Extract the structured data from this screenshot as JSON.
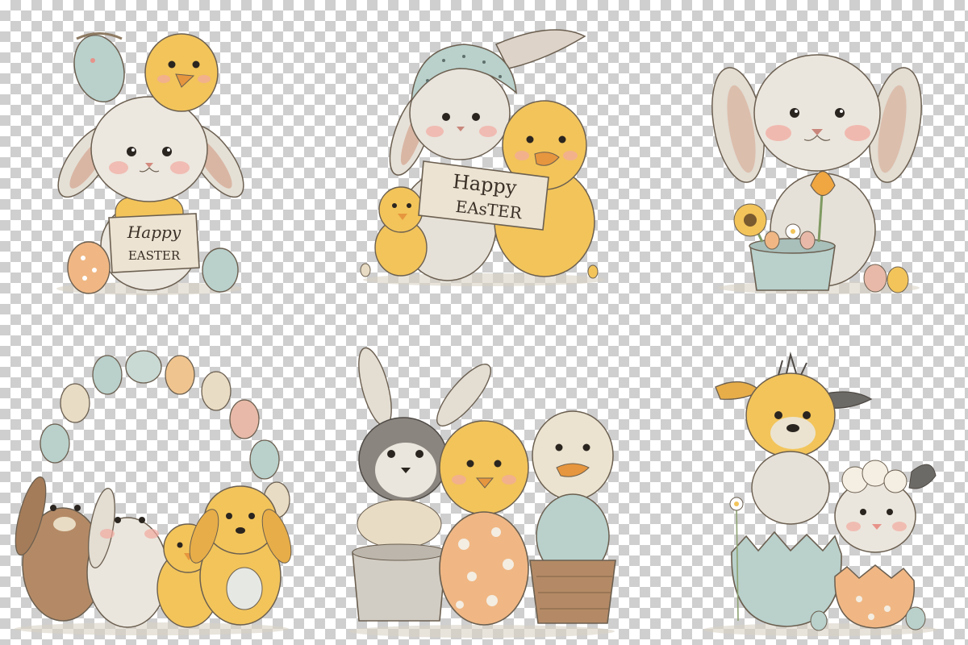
{
  "signs": {
    "sign_1_line_1": "Happy",
    "sign_1_line_2": "EASTER",
    "sign_2_line_1": "Happy",
    "sign_2_line_2": "EAsTER"
  },
  "palette": {
    "checker_light": "#ffffff",
    "checker_dark": "#cfcfcf",
    "chick_yellow": "#f2c45a",
    "bunny_white": "#ece7df",
    "bunny_brown": "#b48a66",
    "egg_blue": "#b9d0cb",
    "egg_peach": "#f0b784",
    "egg_cream": "#e9dcc4",
    "ear_pink": "#e8b9a8",
    "cheek_pink": "#f2a9a0",
    "ink": "#3a3027"
  }
}
